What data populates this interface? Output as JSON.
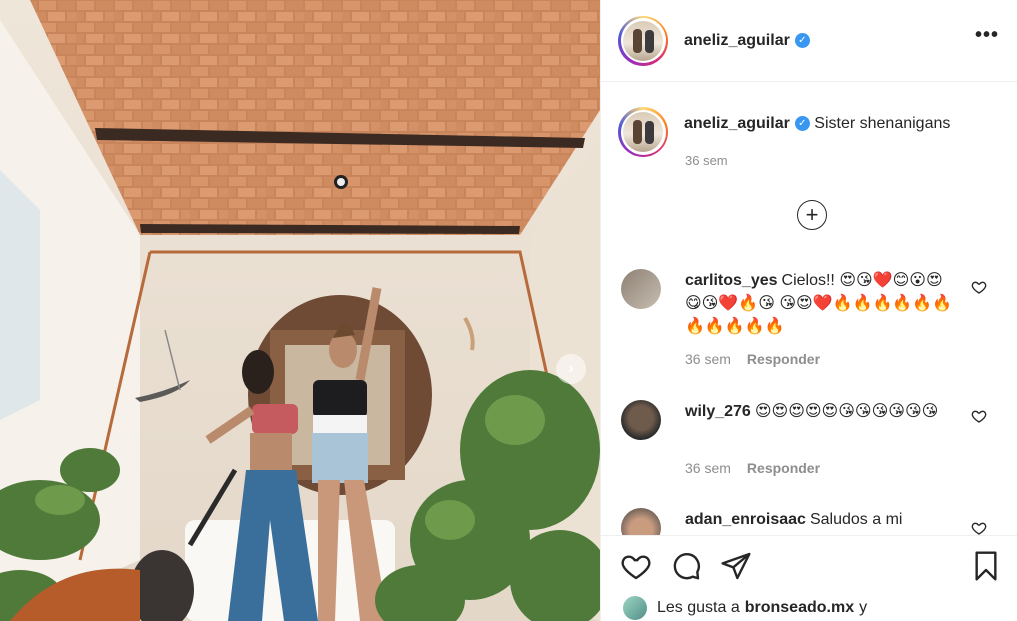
{
  "post": {
    "username": "aneliz_aguilar",
    "caption": "Sister shenanigans",
    "caption_time": "36 sem"
  },
  "comments": [
    {
      "user": "carlitos_yes",
      "text": "Cielos!! 😍😘❤️😊😮😍😋😘❤️🔥😘 😘😍❤️🔥🔥🔥🔥🔥🔥🔥🔥🔥🔥🔥",
      "time": "36 sem",
      "reply": "Responder"
    },
    {
      "user": "wily_276",
      "text": "😍😍😍😍😍😘😘😘😘😘😘",
      "time": "36 sem",
      "reply": "Responder"
    },
    {
      "user": "adan_enroisaac",
      "text": "Saludos a mi"
    }
  ],
  "likes": {
    "prefix": "Les gusta a",
    "user": "bronseado.mx",
    "suffix": "y"
  },
  "icons": {
    "more": "more-options-icon",
    "verified": "verified-badge-icon",
    "load_more": "plus-circle-icon",
    "like": "heart-icon",
    "comment": "comment-bubble-icon",
    "share": "paper-plane-icon",
    "save": "bookmark-icon",
    "next": "chevron-right-icon"
  },
  "colors": {
    "verified": "#3897f0",
    "muted": "#8e8e8e",
    "text": "#262626"
  }
}
